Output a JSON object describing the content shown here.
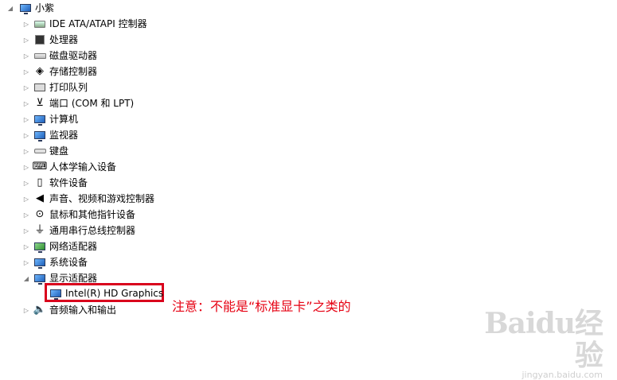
{
  "tree": {
    "root_label": "小紫",
    "items": [
      {
        "label": "IDE ATA/ATAPI 控制器",
        "icon": "ide-controller-icon"
      },
      {
        "label": "处理器",
        "icon": "processor-icon"
      },
      {
        "label": "磁盘驱动器",
        "icon": "disk-drive-icon"
      },
      {
        "label": "存储控制器",
        "icon": "storage-controller-icon"
      },
      {
        "label": "打印队列",
        "icon": "printer-icon"
      },
      {
        "label": "端口 (COM 和 LPT)",
        "icon": "port-icon"
      },
      {
        "label": "计算机",
        "icon": "computer-icon"
      },
      {
        "label": "监视器",
        "icon": "monitor-icon"
      },
      {
        "label": "键盘",
        "icon": "keyboard-icon"
      },
      {
        "label": "人体学输入设备",
        "icon": "hid-icon"
      },
      {
        "label": "软件设备",
        "icon": "software-device-icon"
      },
      {
        "label": "声音、视频和游戏控制器",
        "icon": "sound-icon"
      },
      {
        "label": "鼠标和其他指针设备",
        "icon": "mouse-icon"
      },
      {
        "label": "通用串行总线控制器",
        "icon": "usb-icon"
      },
      {
        "label": "网络适配器",
        "icon": "network-adapter-icon"
      },
      {
        "label": "系统设备",
        "icon": "system-device-icon"
      }
    ],
    "display_adapters_label": "显示适配器",
    "display_child_label": "Intel(R) HD Graphics",
    "audio_io_label": "音频输入和输出"
  },
  "annotation": {
    "text": "注意：不能是“标准显卡”之类的",
    "color": "#e60012"
  },
  "watermark": {
    "logo": "Baidu经验",
    "url": "jingyan.baidu.com"
  }
}
